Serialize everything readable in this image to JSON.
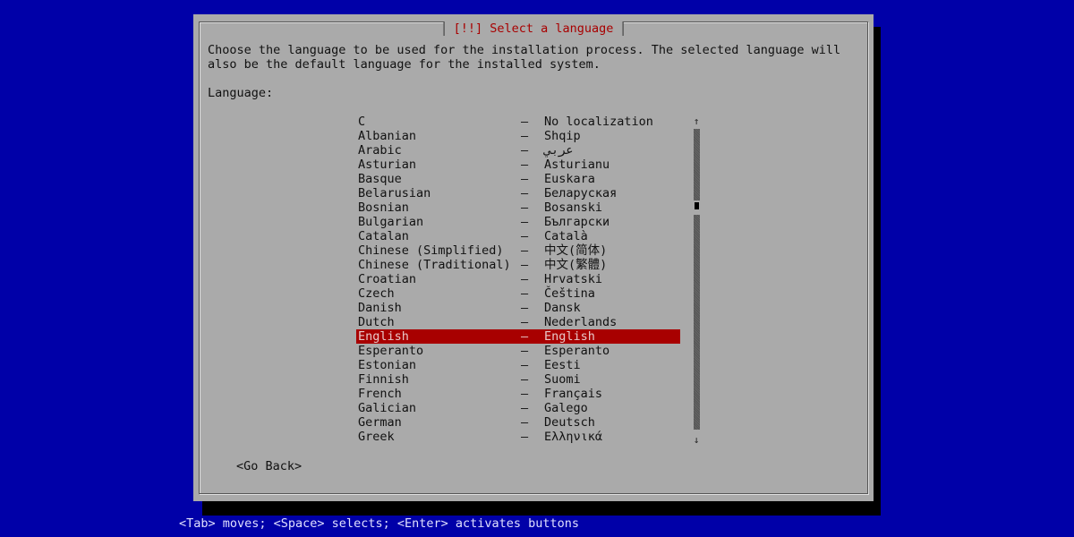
{
  "dialog": {
    "title": "[!!] Select a language",
    "description": "Choose the language to be used for the installation process. The selected language will\nalso be the default language for the installed system.",
    "field_label": "Language:",
    "separator": "–",
    "languages": [
      {
        "name": "C",
        "native": "No localization"
      },
      {
        "name": "Albanian",
        "native": "Shqip"
      },
      {
        "name": "Arabic",
        "native": "عربي"
      },
      {
        "name": "Asturian",
        "native": "Asturianu"
      },
      {
        "name": "Basque",
        "native": "Euskara"
      },
      {
        "name": "Belarusian",
        "native": "Беларуская"
      },
      {
        "name": "Bosnian",
        "native": "Bosanski"
      },
      {
        "name": "Bulgarian",
        "native": "Български"
      },
      {
        "name": "Catalan",
        "native": "Català"
      },
      {
        "name": "Chinese (Simplified)",
        "native": "中文(简体)"
      },
      {
        "name": "Chinese (Traditional)",
        "native": "中文(繁體)"
      },
      {
        "name": "Croatian",
        "native": "Hrvatski"
      },
      {
        "name": "Czech",
        "native": "Čeština"
      },
      {
        "name": "Danish",
        "native": "Dansk"
      },
      {
        "name": "Dutch",
        "native": "Nederlands"
      },
      {
        "name": "English",
        "native": "English",
        "selected": true
      },
      {
        "name": "Esperanto",
        "native": "Esperanto"
      },
      {
        "name": "Estonian",
        "native": "Eesti"
      },
      {
        "name": "Finnish",
        "native": "Suomi"
      },
      {
        "name": "French",
        "native": "Français"
      },
      {
        "name": "Galician",
        "native": "Galego"
      },
      {
        "name": "German",
        "native": "Deutsch"
      },
      {
        "name": "Greek",
        "native": "Ελληνικά"
      }
    ],
    "scrollbar": {
      "up_arrow": "↑",
      "down_arrow": "↓",
      "position_fraction": 0.27
    },
    "go_back_label": "<Go Back>"
  },
  "status_bar": {
    "text": "<Tab> moves; <Space> selects; <Enter> activates buttons"
  },
  "colors": {
    "background": "#0000a8",
    "dialog": "#aaaaaa",
    "title": "#a80000",
    "selection": "#a80000"
  }
}
